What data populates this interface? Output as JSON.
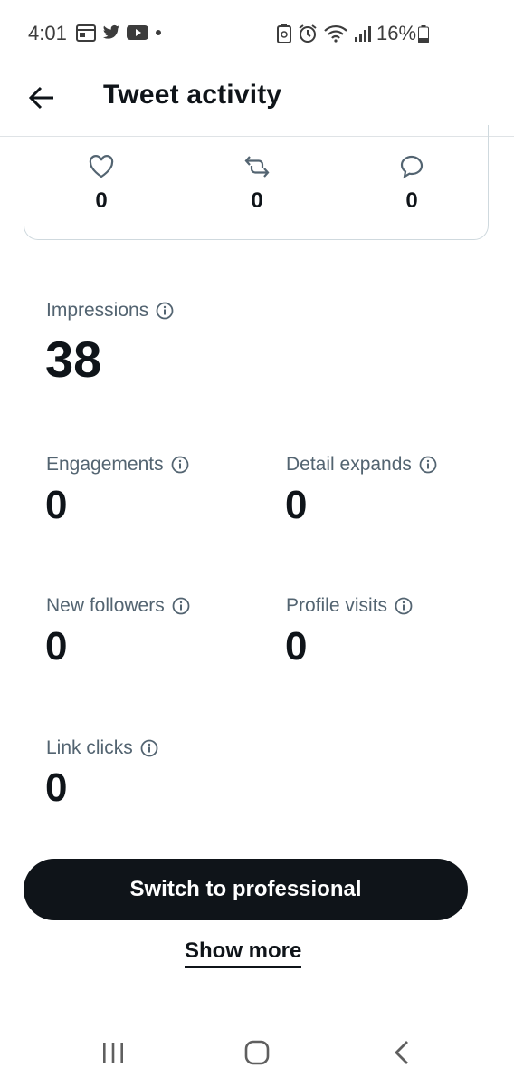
{
  "status_bar": {
    "time": "4:01",
    "battery": "16%"
  },
  "header": {
    "title": "Tweet activity"
  },
  "engagement_card": {
    "likes": "0",
    "retweets": "0",
    "replies": "0"
  },
  "metrics": {
    "impressions": {
      "label": "Impressions",
      "value": "38"
    },
    "engagements": {
      "label": "Engagements",
      "value": "0"
    },
    "detail_expands": {
      "label": "Detail expands",
      "value": "0"
    },
    "new_followers": {
      "label": "New followers",
      "value": "0"
    },
    "profile_visits": {
      "label": "Profile visits",
      "value": "0"
    },
    "link_clicks": {
      "label": "Link clicks",
      "value": "0"
    }
  },
  "actions": {
    "switch_professional": "Switch to professional",
    "show_more": "Show more"
  }
}
